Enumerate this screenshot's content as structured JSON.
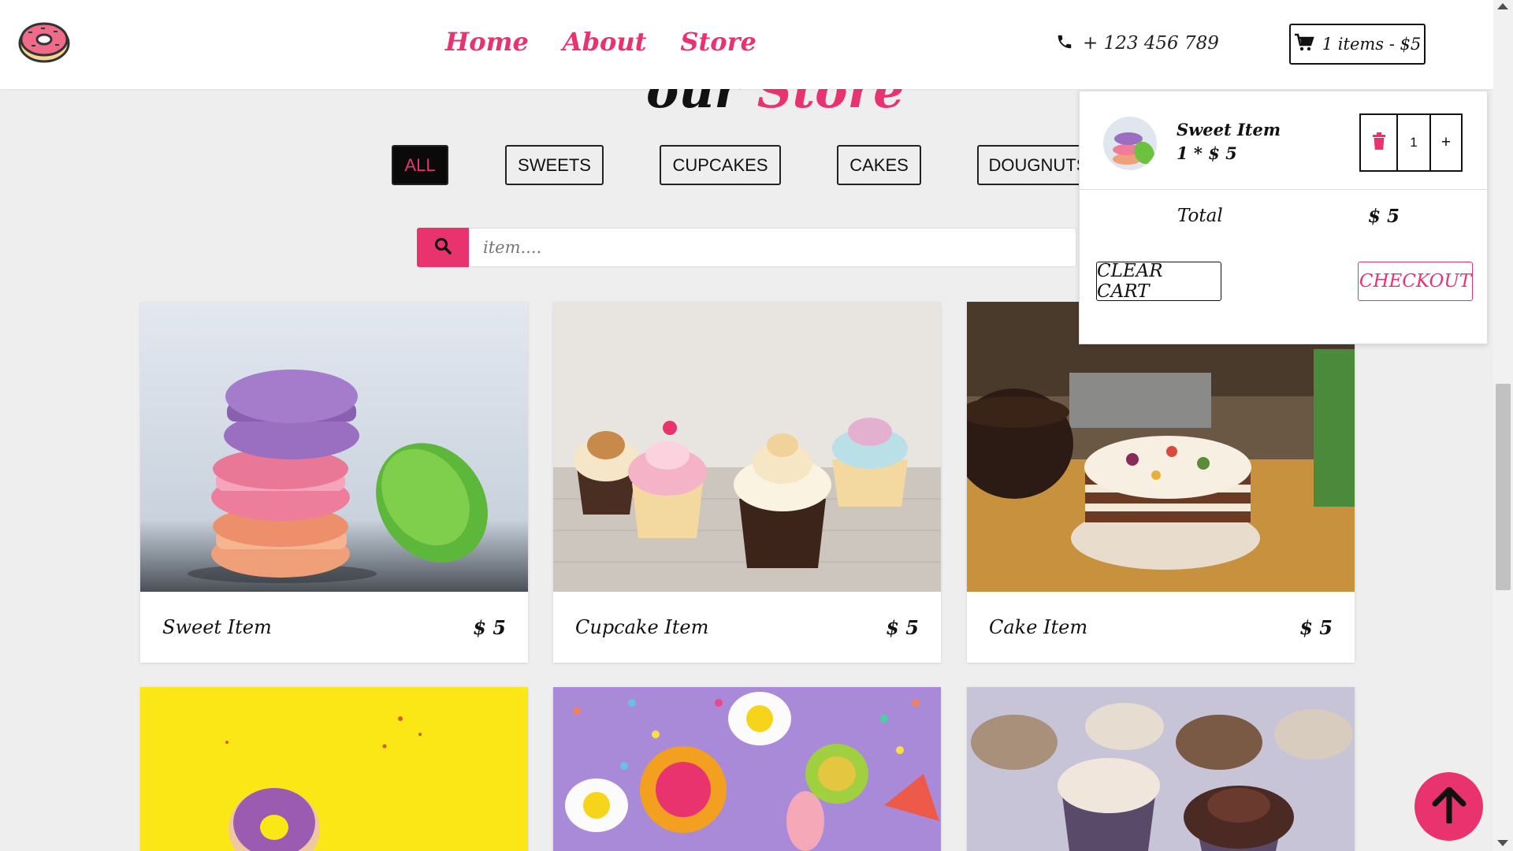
{
  "brand": {
    "logo_icon": "donut-logo-icon"
  },
  "nav": {
    "links": [
      "Home",
      "About",
      "Store"
    ],
    "phone": "+ 123 456 789",
    "cart_summary": "1 items - $5"
  },
  "heading": {
    "word1": "our",
    "word2": "Store"
  },
  "filters": [
    "ALL",
    "SWEETS",
    "CUPCAKES",
    "CAKES",
    "DOUGNUTS"
  ],
  "search": {
    "placeholder": "item...."
  },
  "products": [
    {
      "name": "Sweet Item",
      "price": "$ 5"
    },
    {
      "name": "Cupcake Item",
      "price": "$ 5"
    },
    {
      "name": "Cake Item",
      "price": "$ 5"
    }
  ],
  "cart": {
    "item_name": "Sweet Item",
    "item_line": "1 * $ 5",
    "quantity": "1",
    "plus": "+",
    "total_label": "Total",
    "total_value": "$ 5",
    "clear_label": "CLEAR CART",
    "checkout_label": "CHECKOUT"
  },
  "colors": {
    "accent": "#e8336f",
    "background": "#eeeeee"
  }
}
